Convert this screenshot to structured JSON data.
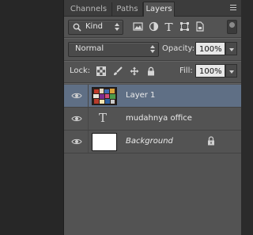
{
  "tabs": [
    {
      "label": "Channels",
      "active": false
    },
    {
      "label": "Paths",
      "active": false
    },
    {
      "label": "Layers",
      "active": true
    }
  ],
  "filter": {
    "kind_label": "Kind",
    "icons": [
      "image-filter-icon",
      "adjustment-filter-icon",
      "type-filter-icon",
      "shape-filter-icon",
      "smart-object-filter-icon"
    ]
  },
  "blend": {
    "mode": "Normal",
    "opacity_label": "Opacity:",
    "opacity_value": "100%"
  },
  "lock": {
    "label": "Lock:",
    "fill_label": "Fill:",
    "fill_value": "100%"
  },
  "layers": [
    {
      "name": "Layer 1",
      "selected": true,
      "type": "image"
    },
    {
      "name": "mudahnya office",
      "selected": false,
      "type": "text",
      "type_glyph": "T"
    },
    {
      "name": "Background",
      "selected": false,
      "type": "background",
      "locked": true
    }
  ],
  "colors": {
    "panel_bg": "#535353",
    "selected_row": "#5f6f85",
    "tabbar_bg": "#3c3c3c"
  }
}
